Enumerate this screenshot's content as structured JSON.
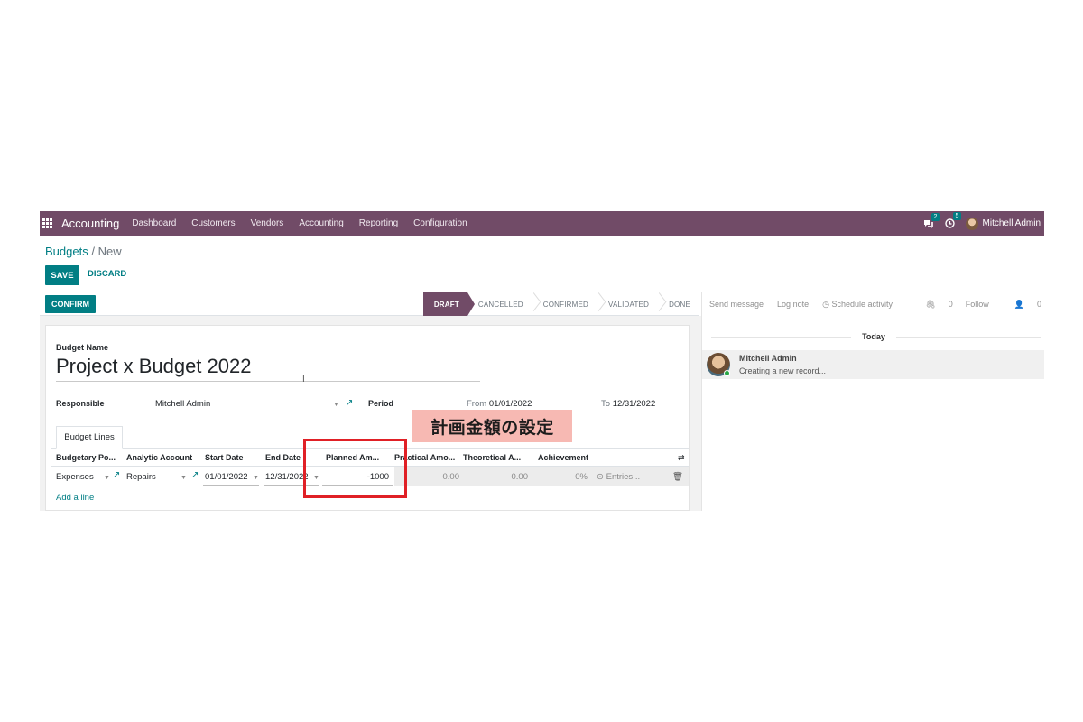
{
  "navbar": {
    "app_name": "Accounting",
    "menu": [
      "Dashboard",
      "Customers",
      "Vendors",
      "Accounting",
      "Reporting",
      "Configuration"
    ],
    "messages_count": "2",
    "activities_count": "5",
    "user_name": "Mitchell Admin",
    "bg_color": "#714B67"
  },
  "breadcrumb": {
    "parent": "Budgets",
    "separator": "/",
    "current": "New"
  },
  "buttons": {
    "save": "SAVE",
    "discard": "DISCARD",
    "confirm": "CONFIRM"
  },
  "stages": [
    "DRAFT",
    "CANCELLED",
    "CONFIRMED",
    "VALIDATED",
    "DONE"
  ],
  "active_stage": "DRAFT",
  "form": {
    "budget_name_label": "Budget Name",
    "budget_name": "Project x Budget 2022",
    "responsible_label": "Responsible",
    "responsible_value": "Mitchell Admin",
    "period_label": "Period",
    "period_from_prefix": "From",
    "period_from": "01/01/2022",
    "period_to_prefix": "To",
    "period_to": "12/31/2022"
  },
  "tabs": {
    "budget_lines": "Budget Lines"
  },
  "table": {
    "headers": [
      "Budgetary Po...",
      "Analytic Account",
      "Start Date",
      "End Date",
      "Planned Am...",
      "Practical Amo...",
      "Theoretical A...",
      "Achievement"
    ],
    "rows": [
      {
        "budgetary_position": "Expenses",
        "analytic_account": "Repairs",
        "start_date": "01/01/2022",
        "end_date": "12/31/2022",
        "planned_amount": "-1000",
        "practical_amount": "0.00",
        "theoretical_amount": "0.00",
        "achievement": "0%",
        "entries": "Entries..."
      }
    ],
    "add_line": "Add a line"
  },
  "annotation": {
    "callout_text": "計画金額の設定",
    "box_color": "#e02026",
    "callout_bg": "#f7b9b3"
  },
  "chatter": {
    "send_message": "Send message",
    "log_note": "Log note",
    "schedule_activity": "Schedule activity",
    "attachments_count": "0",
    "follow": "Follow",
    "followers_count": "0",
    "today_label": "Today",
    "messages": [
      {
        "author": "Mitchell Admin",
        "body": "Creating a new record..."
      }
    ]
  },
  "accent_color": "#017e84"
}
